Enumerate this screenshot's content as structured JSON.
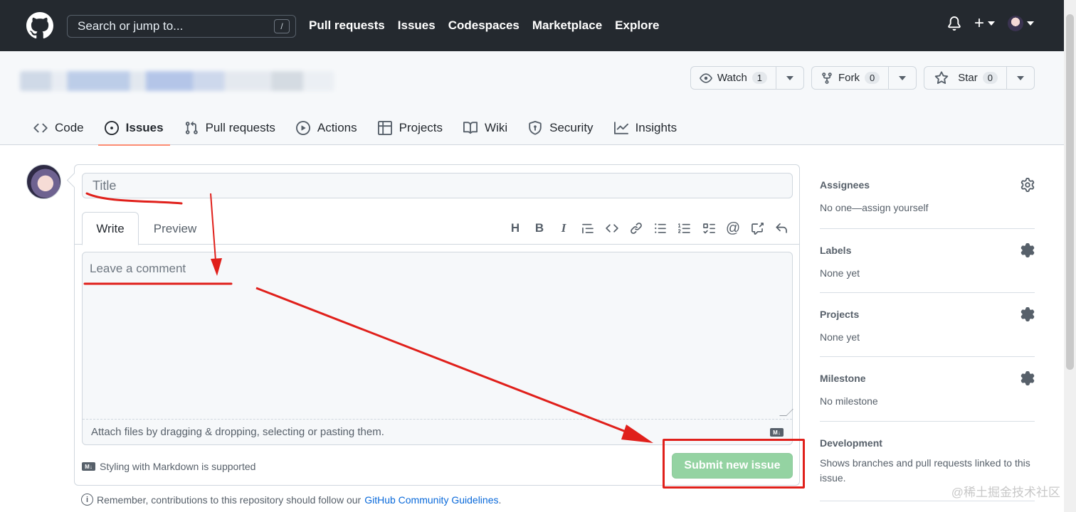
{
  "header": {
    "search_placeholder": "Search or jump to...",
    "search_shortcut": "/",
    "nav": [
      "Pull requests",
      "Issues",
      "Codespaces",
      "Marketplace",
      "Explore"
    ]
  },
  "repo": {
    "watch": {
      "label": "Watch",
      "count": "1"
    },
    "fork": {
      "label": "Fork",
      "count": "0"
    },
    "star": {
      "label": "Star",
      "count": "0"
    },
    "tabs": [
      "Code",
      "Issues",
      "Pull requests",
      "Actions",
      "Projects",
      "Wiki",
      "Security",
      "Insights"
    ],
    "active_tab": "Issues"
  },
  "issue": {
    "title_placeholder": "Title",
    "write_tab": "Write",
    "preview_tab": "Preview",
    "comment_placeholder": "Leave a comment",
    "attach_text": "Attach files by dragging & dropping, selecting or pasting them.",
    "markdown_note": "Styling with Markdown is supported",
    "submit_label": "Submit new issue",
    "md_badge": "M↓",
    "toolbar_icons": [
      "heading-icon",
      "bold-icon",
      "italic-icon",
      "quote-icon",
      "code-icon",
      "link-icon",
      "bulleted-list-icon",
      "numbered-list-icon",
      "task-list-icon",
      "mention-icon",
      "cross-reference-icon",
      "reply-icon"
    ]
  },
  "remember": {
    "text": "Remember, contributions to this repository should follow our",
    "link": "GitHub Community Guidelines",
    "end": "."
  },
  "sidebar": {
    "assignees": {
      "label": "Assignees",
      "value": "No one—assign yourself"
    },
    "labels": {
      "label": "Labels",
      "value": "None yet"
    },
    "projects": {
      "label": "Projects",
      "value": "None yet"
    },
    "milestone": {
      "label": "Milestone",
      "value": "No milestone"
    },
    "development": {
      "label": "Development",
      "value": "Shows branches and pull requests linked to this issue."
    }
  },
  "watermark": "@稀土掘金技术社区",
  "colors": {
    "accent": "#fd8c73",
    "submit": "#94d3a2",
    "annotation": "#e0201b",
    "header_bg": "#24292f"
  }
}
